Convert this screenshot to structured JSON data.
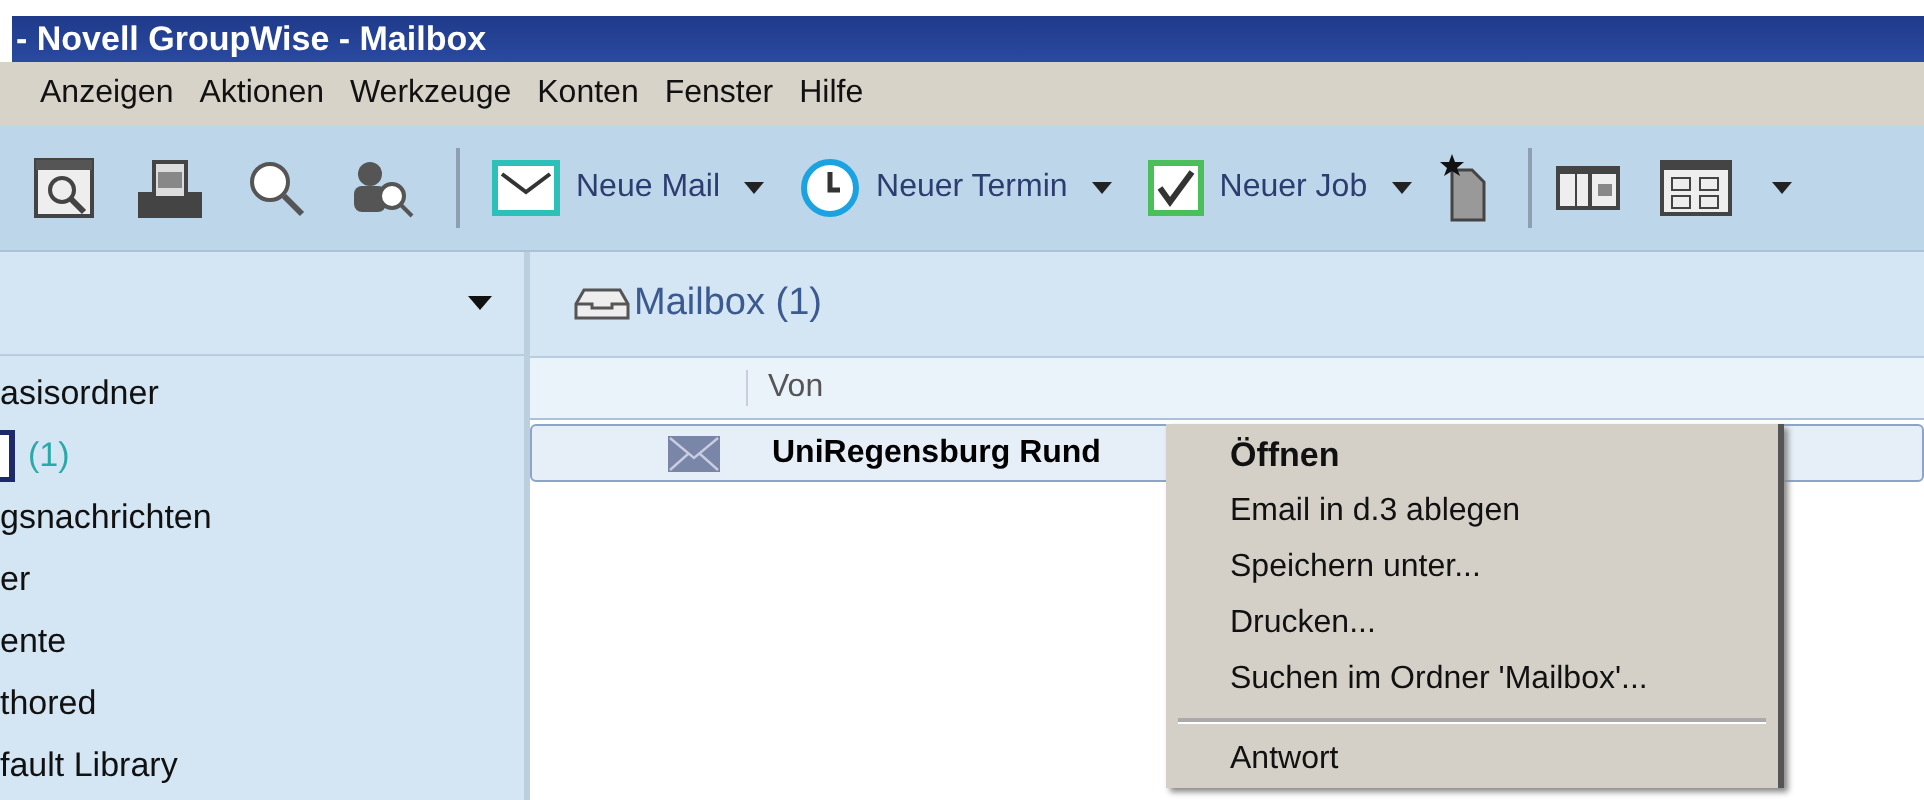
{
  "window": {
    "title": "- Novell GroupWise - Mailbox"
  },
  "menu": [
    "Anzeigen",
    "Aktionen",
    "Werkzeuge",
    "Konten",
    "Fenster",
    "Hilfe"
  ],
  "toolbar": {
    "new_buttons": [
      {
        "label": "Neue Mail"
      },
      {
        "label": "Neuer Termin"
      },
      {
        "label": "Neuer Job"
      }
    ]
  },
  "sidebar": {
    "items": [
      {
        "label": "asisordner"
      },
      {
        "label": "(1)",
        "kind": "count"
      },
      {
        "label": "gsnachrichten"
      },
      {
        "label": "er"
      },
      {
        "label": "ente"
      },
      {
        "label": "thored"
      },
      {
        "label": "fault Library"
      }
    ]
  },
  "mailbox": {
    "title": "Mailbox (1)",
    "columns": [
      "Von"
    ],
    "rows": [
      {
        "from": "UniRegensburg Rund",
        "unread": true,
        "selected": true
      }
    ]
  },
  "context_menu": [
    {
      "label": "Öffnen",
      "kind": "default"
    },
    {
      "label": "Email in d.3 ablegen",
      "kind": "item"
    },
    {
      "label": "Speichern unter...",
      "kind": "item"
    },
    {
      "label": "Drucken...",
      "kind": "item"
    },
    {
      "label": "Suchen im Ordner 'Mailbox'...",
      "kind": "item"
    },
    {
      "kind": "separator"
    },
    {
      "label": "Antwort",
      "kind": "item"
    }
  ]
}
